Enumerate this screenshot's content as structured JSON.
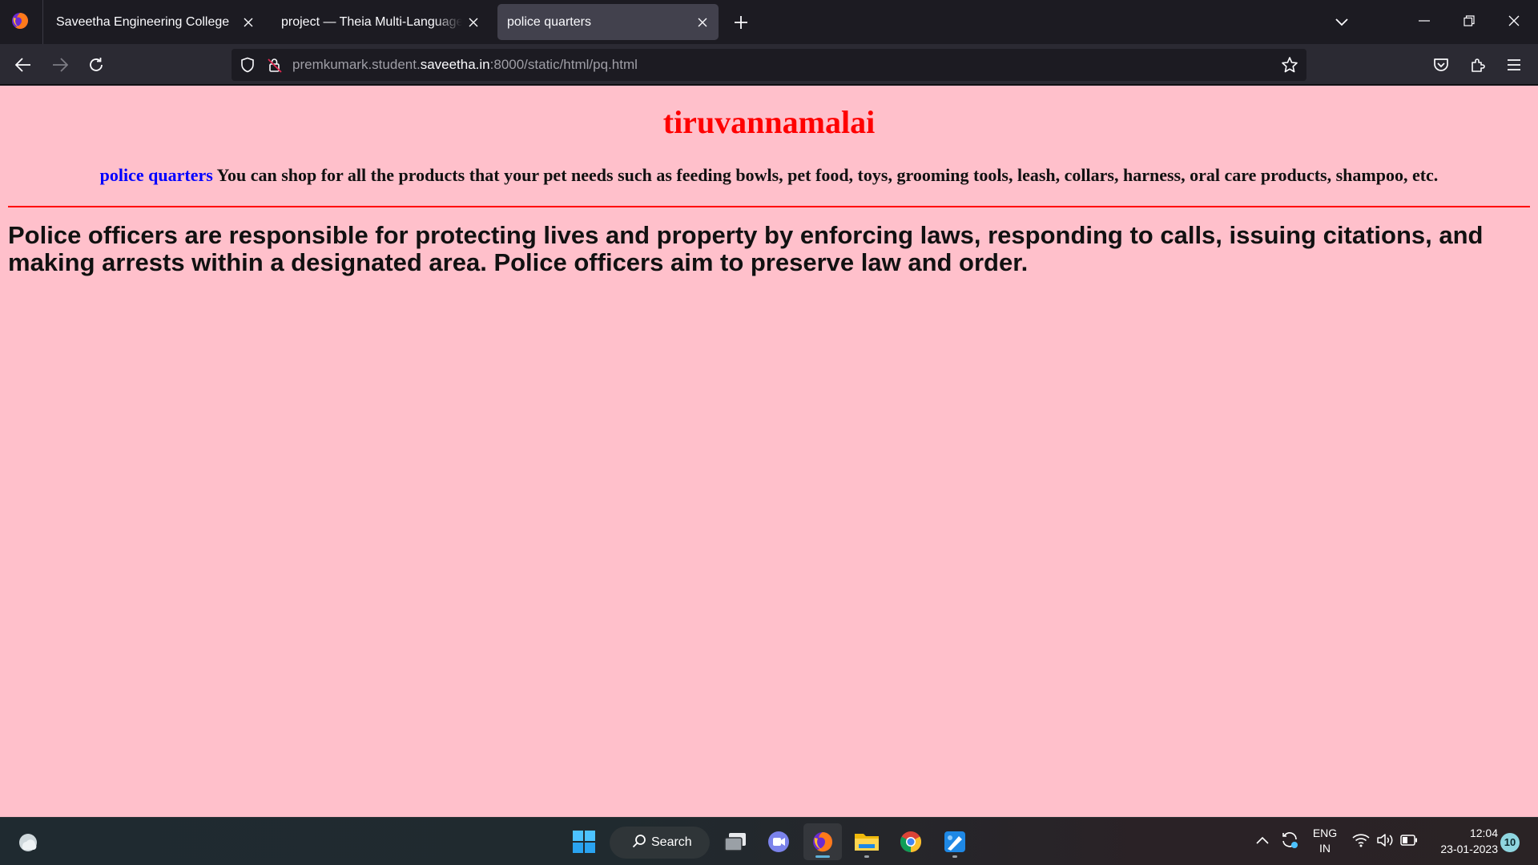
{
  "browser": {
    "tabs": [
      {
        "label": "Saveetha Engineering College"
      },
      {
        "label": "project — Theia Multi-Language Ex"
      },
      {
        "label": "police quarters"
      }
    ],
    "url": {
      "prefix": "premkumark.student.",
      "host": "saveetha.in",
      "suffix": ":8000/static/html/pq.html"
    }
  },
  "page": {
    "title": "tiruvannamalai",
    "link_text": "police quarters",
    "subline": " You can shop for all the products that your pet needs such as feeding bowls, pet food, toys, grooming tools, leash, collars, harness, oral care products, shampoo, etc.",
    "body": "Police officers are responsible for protecting lives and property by enforcing laws, responding to calls, issuing citations, and making arrests within a designated area. Police officers aim to preserve law and order.",
    "colors": {
      "background": "#ffc0cb",
      "title": "#ff0000",
      "link": "#0000ff",
      "rule": "#ff0000"
    }
  },
  "taskbar": {
    "search_label": "Search",
    "lang_line1": "ENG",
    "lang_line2": "IN",
    "time": "12:04",
    "date": "23-01-2023",
    "notification_count": "10"
  }
}
